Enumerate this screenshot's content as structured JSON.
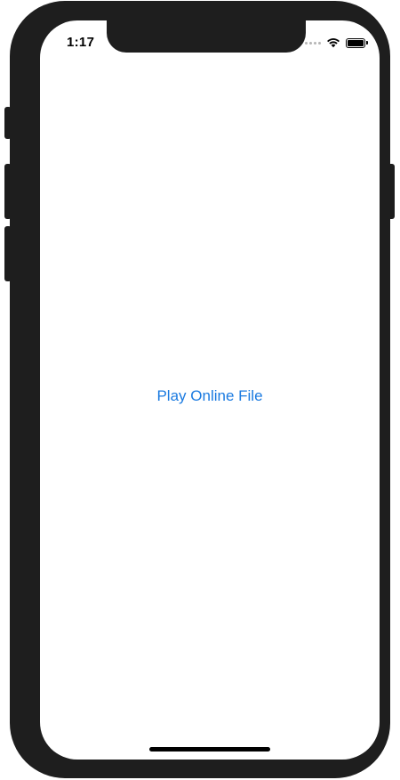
{
  "status_bar": {
    "time": "1:17",
    "icons": [
      "cellular-dots-icon",
      "wifi-icon",
      "battery-icon"
    ],
    "battery_level": 1.0
  },
  "main": {
    "play_button_label": "Play Online File"
  },
  "colors": {
    "accent": "#1a7ae0",
    "frame": "#1e1e1e",
    "background": "#ffffff"
  }
}
